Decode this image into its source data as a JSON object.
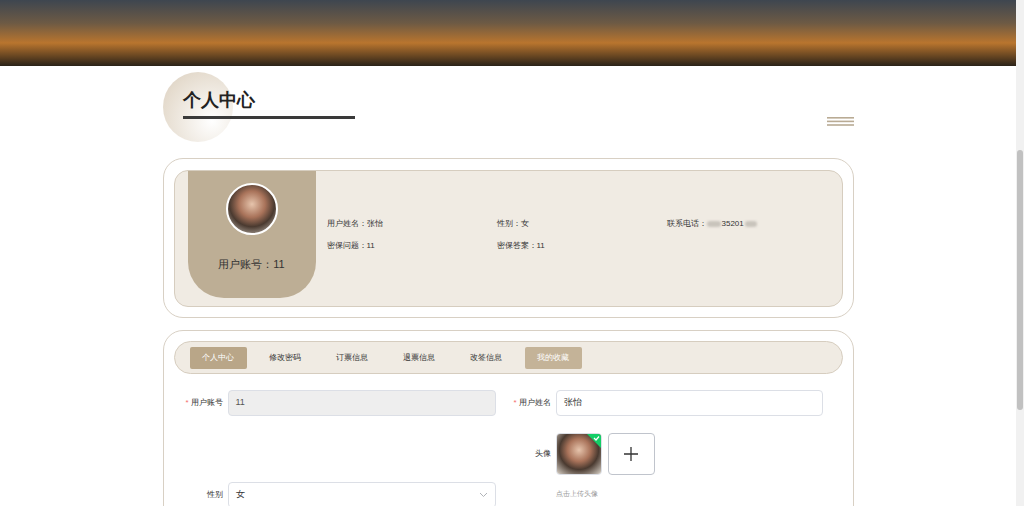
{
  "page_title": "个人中心",
  "profile": {
    "account_label": "用户账号：",
    "account": "11",
    "fields": [
      {
        "label": "用户姓名：",
        "value": "张怡",
        "blurred": false
      },
      {
        "label": "性别：",
        "value": "女",
        "blurred": false
      },
      {
        "label": "联系电话：",
        "value": "35201",
        "blurred": true
      },
      {
        "label": "密保问题：",
        "value": "11",
        "blurred": false
      },
      {
        "label": "密保答案：",
        "value": "11",
        "blurred": false
      }
    ]
  },
  "tabs": [
    {
      "label": "个人中心",
      "selected": true,
      "hovered": false
    },
    {
      "label": "修改密码",
      "selected": false,
      "hovered": false
    },
    {
      "label": "订票信息",
      "selected": false,
      "hovered": false
    },
    {
      "label": "退票信息",
      "selected": false,
      "hovered": false
    },
    {
      "label": "改签信息",
      "selected": false,
      "hovered": false
    },
    {
      "label": "我的收藏",
      "selected": false,
      "hovered": true
    }
  ],
  "form": {
    "required_mark": "*",
    "fields": [
      {
        "label": "用户账号",
        "value": "11",
        "required": true,
        "disabled": true
      },
      {
        "label": "用户姓名",
        "value": "张怡",
        "required": true,
        "disabled": false
      }
    ],
    "avatar": {
      "label": "头像",
      "uploaded": true,
      "hint": "点击上传头像"
    },
    "gender": {
      "label": "性别",
      "value": "女",
      "required": false
    }
  }
}
